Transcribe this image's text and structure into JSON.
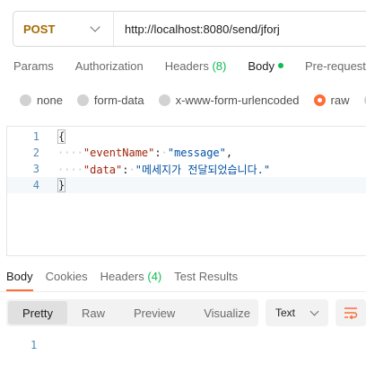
{
  "request": {
    "method": "POST",
    "url": "http://localhost:8080/send/jforj"
  },
  "request_tabs": [
    {
      "label": "Params"
    },
    {
      "label": "Authorization"
    },
    {
      "label": "Headers",
      "count": "(8)"
    },
    {
      "label": "Body"
    },
    {
      "label": "Pre-request"
    }
  ],
  "body_types": [
    {
      "label": "none"
    },
    {
      "label": "form-data"
    },
    {
      "label": "x-www-form-urlencoded"
    },
    {
      "label": "raw"
    }
  ],
  "editor": {
    "line_numbers": [
      "1",
      "2",
      "3",
      "4"
    ],
    "open_brace": "{",
    "close_brace": "}",
    "key1": "\"eventName\"",
    "val1": "\"message\"",
    "key2": "\"data\"",
    "val2": "\"메세지가 전달되었습니다.\""
  },
  "response_tabs": [
    {
      "label": "Body"
    },
    {
      "label": "Cookies"
    },
    {
      "label": "Headers",
      "count": "(4)"
    },
    {
      "label": "Test Results"
    }
  ],
  "view_modes": [
    "Pretty",
    "Raw",
    "Preview",
    "Visualize"
  ],
  "format": "Text",
  "response_line_number": "1",
  "colors": {
    "accent": "#ff6c37",
    "method": "#a66b00",
    "success": "#0cbb52"
  }
}
